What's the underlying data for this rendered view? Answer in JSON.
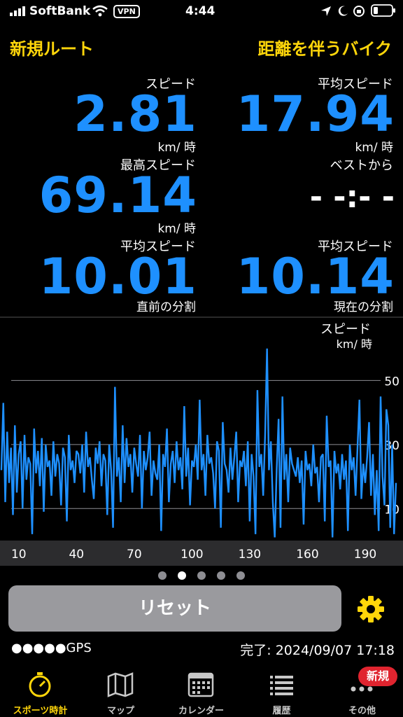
{
  "status_bar": {
    "carrier": "SoftBank",
    "vpn": "VPN",
    "time": "4:44"
  },
  "header": {
    "left": "新規ルート",
    "right": "距離を伴うバイク"
  },
  "metrics": {
    "speed": {
      "label": "スピード",
      "value": "2.81",
      "unit": "km/ 時"
    },
    "avg_speed": {
      "label": "平均スピード",
      "value": "17.94",
      "unit": "km/ 時"
    },
    "max_speed": {
      "label": "最高スピード",
      "value": "69.14",
      "unit": "km/ 時"
    },
    "from_best": {
      "label": "ベストから",
      "value": "- -:- -"
    },
    "prev_split": {
      "label": "平均スピード",
      "value": "10.01",
      "unit": "直前の分割"
    },
    "cur_split": {
      "label": "平均スピード",
      "value": "10.14",
      "unit": "現在の分割"
    }
  },
  "chart_data": {
    "type": "line",
    "ylabel": "スピード",
    "yunit": "km/ 時",
    "x_ticks": [
      10,
      40,
      70,
      100,
      130,
      160,
      190
    ],
    "y_ticks": [
      10,
      30,
      50
    ],
    "xlim": [
      1,
      198
    ],
    "ylim": [
      0,
      70
    ],
    "color": "#1e90ff",
    "series": [
      {
        "values": [
          22,
          43,
          12,
          34,
          18,
          29,
          8,
          36,
          15,
          27,
          31,
          10,
          33,
          19,
          26,
          24,
          2,
          35,
          21,
          28,
          17,
          32,
          9,
          30,
          23,
          25,
          14,
          31,
          20,
          27,
          24,
          11,
          29,
          26,
          6,
          33,
          22,
          25,
          18,
          28,
          27,
          21,
          30,
          15,
          34,
          23,
          26,
          19,
          13,
          29,
          24,
          31,
          17,
          27,
          25,
          8,
          30,
          22,
          4,
          48,
          20,
          26,
          12,
          36,
          18,
          32,
          23,
          27,
          15,
          29,
          24,
          20,
          33,
          10,
          28,
          22,
          26,
          34,
          14,
          25,
          21,
          19,
          30,
          3,
          27,
          23,
          35,
          12,
          24,
          28,
          18,
          31,
          22,
          26,
          16,
          42,
          20,
          29,
          11,
          25,
          23,
          30,
          19,
          44,
          22,
          27,
          14,
          33,
          24,
          26,
          21,
          10,
          31,
          28,
          4,
          37,
          24,
          22,
          15,
          29,
          19,
          26,
          34,
          12,
          25,
          23,
          28,
          17,
          31,
          6,
          27,
          20,
          2,
          47,
          23,
          27,
          14,
          33,
          60,
          22,
          31,
          12,
          1,
          22,
          38,
          4,
          45,
          19,
          27,
          12,
          29,
          24,
          22,
          20,
          26,
          18,
          25,
          5,
          28,
          22,
          24,
          17,
          30,
          21,
          23,
          12,
          26,
          27,
          6,
          39,
          23,
          25,
          1,
          28,
          21,
          24,
          16,
          27,
          19,
          25,
          3,
          30,
          22,
          26,
          14,
          29,
          44,
          13,
          24,
          18,
          26,
          37,
          14,
          27,
          8,
          22,
          3,
          45,
          20,
          11,
          41,
          36,
          4,
          30,
          2,
          18
        ]
      }
    ]
  },
  "page_dots": {
    "count": 5,
    "active": 1
  },
  "reset_label": "リセット",
  "gps_label": "●●●●●GPS",
  "completed_text": "完了: 2024/09/07 17:18",
  "tabs": [
    {
      "label": "スポーツ時計",
      "icon": "stopwatch-icon"
    },
    {
      "label": "マップ",
      "icon": "map-icon"
    },
    {
      "label": "カレンダー",
      "icon": "calendar-icon"
    },
    {
      "label": "履歴",
      "icon": "list-icon"
    },
    {
      "label": "その他",
      "icon": "more-icon"
    }
  ],
  "badge": "新規",
  "colors": {
    "accent": "#ffd60a",
    "value": "#1e90ff",
    "badge": "#e0242f"
  }
}
